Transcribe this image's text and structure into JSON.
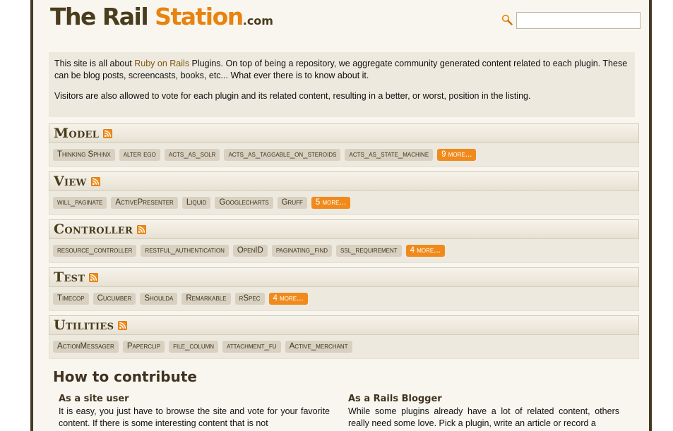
{
  "logo": {
    "part1": "The Rail ",
    "part2": "Station",
    "part3": ".com"
  },
  "search": {
    "placeholder": "",
    "value": ""
  },
  "intro": {
    "p1_before": "This site is all about ",
    "p1_link": "Ruby on Rails",
    "p1_after": " Plugins. On top of being a repository, we aggregate community generated content related to each plugin. These can be blog posts, screencasts, books, etc... What ever there is to know about it.",
    "p2": "Visitors are also allowed to vote for each plugin and its related content, resulting in a better, or worst, position in the listing."
  },
  "categories": [
    {
      "title": "Model",
      "tags": [
        "Thinking Sphinx",
        "alter ego",
        "acts_as_solr",
        "acts_as_taggable_on_steroids",
        "acts_as_state_machine"
      ],
      "more": "9 more..."
    },
    {
      "title": "View",
      "tags": [
        "will_paginate",
        "ActivePresenter",
        "Liquid",
        "Googlecharts",
        "Gruff"
      ],
      "more": "5 more..."
    },
    {
      "title": "Controller",
      "tags": [
        "resource_controller",
        "restful_authentication",
        "OpenID",
        "paginating_find",
        "ssl_requirement"
      ],
      "more": "4 more..."
    },
    {
      "title": "Test",
      "tags": [
        "Timecop",
        "Cucumber",
        "Shoulda",
        "Remarkable",
        "rSpec"
      ],
      "more": "4 more..."
    },
    {
      "title": "Utilities",
      "tags": [
        "ActionMessager",
        "Paperclip",
        "file_column",
        "attachment_fu",
        "Active_merchant"
      ],
      "more": ""
    }
  ],
  "contribute": {
    "title": "How to contribute",
    "site_user": {
      "heading": "As a site user",
      "text": "It is easy, you just have to browse the site and vote for your favorite content. If there is some interesting content that is not"
    },
    "blogger": {
      "heading": "As a Rails Blogger",
      "text": "While some plugins already have a lot of related content, others really need some love. Pick a plugin, write an article or record a"
    }
  },
  "icons": {
    "search": "search-icon",
    "feed": "rss-icon"
  },
  "colors": {
    "brand_orange": "#e8830f",
    "brand_brown": "#4a3c1c",
    "more_badge": "#f08a1c",
    "frame": "#453a25"
  }
}
